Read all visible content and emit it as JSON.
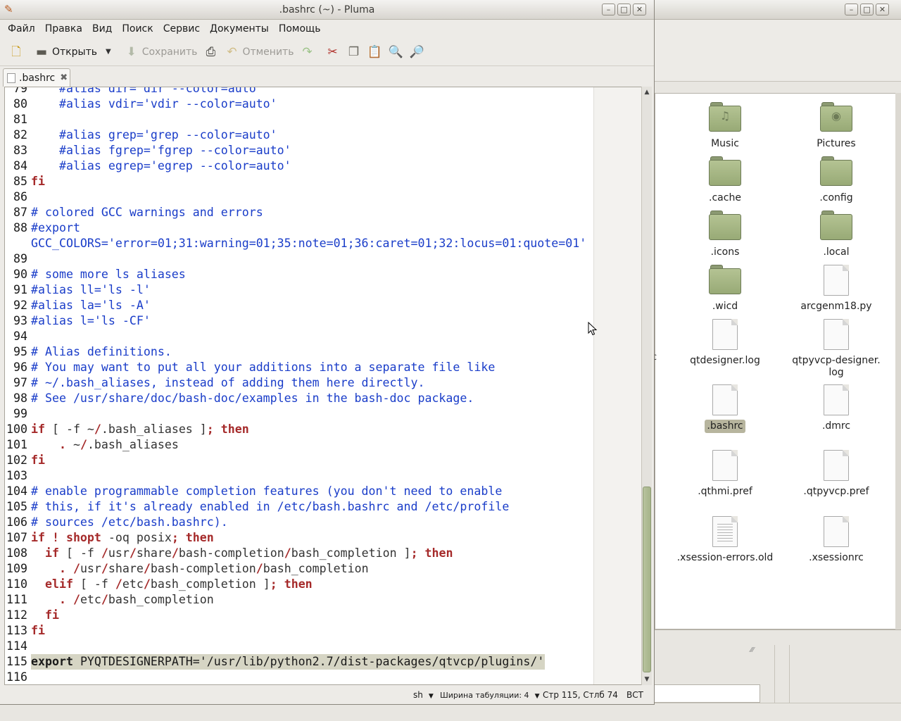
{
  "pluma": {
    "title": ".bashrc (~) - Pluma",
    "menus": [
      "Файл",
      "Правка",
      "Вид",
      "Поиск",
      "Сервис",
      "Документы",
      "Помощь"
    ],
    "toolbar": {
      "new_icon": "new-document-icon",
      "open_label": "Открыть",
      "save_label": "Сохранить",
      "undo_label": "Отменить"
    },
    "tab": {
      "name": ".bashrc"
    },
    "status": {
      "language": "sh",
      "tab_width": "Ширина табуляции: 4",
      "position": "Стр 115, Стлб 74",
      "mode": "ВСТ"
    }
  },
  "editor": {
    "lines": [
      {
        "n": "79",
        "segs": [
          {
            "c": "c-com",
            "t": "    #alias dir='dir --color=auto'"
          }
        ]
      },
      {
        "n": "80",
        "segs": [
          {
            "c": "c-com",
            "t": "    #alias vdir='vdir --color=auto'"
          }
        ]
      },
      {
        "n": "81",
        "segs": []
      },
      {
        "n": "82",
        "segs": [
          {
            "c": "c-com",
            "t": "    #alias grep='grep --color=auto'"
          }
        ]
      },
      {
        "n": "83",
        "segs": [
          {
            "c": "c-com",
            "t": "    #alias fgrep='fgrep --color=auto'"
          }
        ]
      },
      {
        "n": "84",
        "segs": [
          {
            "c": "c-com",
            "t": "    #alias egrep='egrep --color=auto'"
          }
        ]
      },
      {
        "n": "85",
        "segs": [
          {
            "c": "c-kw",
            "t": "fi"
          }
        ]
      },
      {
        "n": "86",
        "segs": []
      },
      {
        "n": "87",
        "segs": [
          {
            "c": "c-com",
            "t": "# colored GCC warnings and errors"
          }
        ]
      },
      {
        "n": "88",
        "segs": [
          {
            "c": "c-com",
            "t": "#export"
          }
        ]
      },
      {
        "n": "",
        "segs": [
          {
            "c": "c-com",
            "t": "GCC_COLORS='error=01;31:warning=01;35:note=01;36:caret=01;32:locus=01:quote=01'"
          }
        ]
      },
      {
        "n": "89",
        "segs": []
      },
      {
        "n": "90",
        "segs": [
          {
            "c": "c-com",
            "t": "# some more ls aliases"
          }
        ]
      },
      {
        "n": "91",
        "segs": [
          {
            "c": "c-com",
            "t": "#alias ll='ls -l'"
          }
        ]
      },
      {
        "n": "92",
        "segs": [
          {
            "c": "c-com",
            "t": "#alias la='ls -A'"
          }
        ]
      },
      {
        "n": "93",
        "segs": [
          {
            "c": "c-com",
            "t": "#alias l='ls -CF'"
          }
        ]
      },
      {
        "n": "94",
        "segs": []
      },
      {
        "n": "95",
        "segs": [
          {
            "c": "c-com",
            "t": "# Alias definitions."
          }
        ]
      },
      {
        "n": "96",
        "segs": [
          {
            "c": "c-com",
            "t": "# You may want to put all your additions into a separate file like"
          }
        ]
      },
      {
        "n": "97",
        "segs": [
          {
            "c": "c-com",
            "t": "# ~/.bash_aliases, instead of adding them here directly."
          }
        ]
      },
      {
        "n": "98",
        "segs": [
          {
            "c": "c-com",
            "t": "# See /usr/share/doc/bash-doc/examples in the bash-doc package."
          }
        ]
      },
      {
        "n": "99",
        "segs": []
      },
      {
        "n": "100",
        "segs": [
          {
            "c": "c-kw",
            "t": "if"
          },
          {
            "c": "c-txt",
            "t": " [ -f ~"
          },
          {
            "c": "c-kw",
            "t": "/"
          },
          {
            "c": "c-txt",
            "t": ".bash_aliases ]"
          },
          {
            "c": "c-kw",
            "t": "; then"
          }
        ]
      },
      {
        "n": "101",
        "segs": [
          {
            "c": "c-kw",
            "t": "    ."
          },
          {
            "c": "c-txt",
            "t": " ~"
          },
          {
            "c": "c-kw",
            "t": "/"
          },
          {
            "c": "c-txt",
            "t": ".bash_aliases"
          }
        ]
      },
      {
        "n": "102",
        "segs": [
          {
            "c": "c-kw",
            "t": "fi"
          }
        ]
      },
      {
        "n": "103",
        "segs": []
      },
      {
        "n": "104",
        "segs": [
          {
            "c": "c-com",
            "t": "# enable programmable completion features (you don't need to enable"
          }
        ]
      },
      {
        "n": "105",
        "segs": [
          {
            "c": "c-com",
            "t": "# this, if it's already enabled in /etc/bash.bashrc and /etc/profile"
          }
        ]
      },
      {
        "n": "106",
        "segs": [
          {
            "c": "c-com",
            "t": "# sources /etc/bash.bashrc)."
          }
        ]
      },
      {
        "n": "107",
        "segs": [
          {
            "c": "c-kw",
            "t": "if ! shopt"
          },
          {
            "c": "c-txt",
            "t": " -oq posix"
          },
          {
            "c": "c-kw",
            "t": "; then"
          }
        ]
      },
      {
        "n": "108",
        "segs": [
          {
            "c": "c-kw",
            "t": "  if"
          },
          {
            "c": "c-txt",
            "t": " [ -f "
          },
          {
            "c": "c-kw",
            "t": "/"
          },
          {
            "c": "c-txt",
            "t": "usr"
          },
          {
            "c": "c-kw",
            "t": "/"
          },
          {
            "c": "c-txt",
            "t": "share"
          },
          {
            "c": "c-kw",
            "t": "/"
          },
          {
            "c": "c-txt",
            "t": "bash-completion"
          },
          {
            "c": "c-kw",
            "t": "/"
          },
          {
            "c": "c-txt",
            "t": "bash_completion ]"
          },
          {
            "c": "c-kw",
            "t": "; then"
          }
        ]
      },
      {
        "n": "109",
        "segs": [
          {
            "c": "c-kw",
            "t": "    . /"
          },
          {
            "c": "c-txt",
            "t": "usr"
          },
          {
            "c": "c-kw",
            "t": "/"
          },
          {
            "c": "c-txt",
            "t": "share"
          },
          {
            "c": "c-kw",
            "t": "/"
          },
          {
            "c": "c-txt",
            "t": "bash-completion"
          },
          {
            "c": "c-kw",
            "t": "/"
          },
          {
            "c": "c-txt",
            "t": "bash_completion"
          }
        ]
      },
      {
        "n": "110",
        "segs": [
          {
            "c": "c-kw",
            "t": "  elif"
          },
          {
            "c": "c-txt",
            "t": " [ -f "
          },
          {
            "c": "c-kw",
            "t": "/"
          },
          {
            "c": "c-txt",
            "t": "etc"
          },
          {
            "c": "c-kw",
            "t": "/"
          },
          {
            "c": "c-txt",
            "t": "bash_completion ]"
          },
          {
            "c": "c-kw",
            "t": "; then"
          }
        ]
      },
      {
        "n": "111",
        "segs": [
          {
            "c": "c-kw",
            "t": "    . /"
          },
          {
            "c": "c-txt",
            "t": "etc"
          },
          {
            "c": "c-kw",
            "t": "/"
          },
          {
            "c": "c-txt",
            "t": "bash_completion"
          }
        ]
      },
      {
        "n": "112",
        "segs": [
          {
            "c": "c-kw",
            "t": "  fi"
          }
        ]
      },
      {
        "n": "113",
        "segs": [
          {
            "c": "c-kw",
            "t": "fi"
          }
        ]
      },
      {
        "n": "114",
        "segs": []
      },
      {
        "n": "115",
        "hl": true,
        "segs": [
          {
            "c": "c-bold",
            "t": "export"
          },
          {
            "c": "c-var",
            "t": " PYQTDESIGNERPATH="
          },
          {
            "c": "c-hlstr",
            "t": "'/usr/lib/python2.7/dist-packages/qtvcp/plugins/'"
          }
        ]
      },
      {
        "n": "116",
        "segs": []
      }
    ]
  },
  "file_manager": {
    "items": [
      {
        "label": "Music",
        "kind": "folder",
        "icon": "music-folder-icon",
        "emblem": "♫"
      },
      {
        "label": "Pictures",
        "kind": "folder",
        "icon": "pictures-folder-icon",
        "emblem": "◉"
      },
      {
        "label": ".cache",
        "kind": "folder",
        "icon": "folder-icon",
        "emblem": ""
      },
      {
        "label": ".config",
        "kind": "folder",
        "icon": "folder-icon",
        "emblem": ""
      },
      {
        "label": ".icons",
        "kind": "folder",
        "icon": "folder-icon",
        "emblem": ""
      },
      {
        "label": ".local",
        "kind": "folder",
        "icon": "folder-icon",
        "emblem": ""
      },
      {
        "label": ".wicd",
        "kind": "folder",
        "icon": "folder-icon",
        "emblem": ""
      },
      {
        "label": "arcgenm18.py",
        "kind": "file",
        "icon": "text-file-icon"
      },
      {
        "label": "qtdesigner.log",
        "kind": "file",
        "icon": "text-file-icon"
      },
      {
        "label": "qtpyvcp-designer.\nlog",
        "kind": "file",
        "icon": "text-file-icon"
      },
      {
        "label": ".bashrc",
        "kind": "file",
        "icon": "text-file-icon",
        "selected": true
      },
      {
        "label": ".dmrc",
        "kind": "file",
        "icon": "text-file-icon"
      },
      {
        "label": ".qthmi.pref",
        "kind": "file",
        "icon": "text-file-icon"
      },
      {
        "label": ".qtpyvcp.pref",
        "kind": "file",
        "icon": "text-file-icon"
      },
      {
        "label": ".xsession-errors.old",
        "kind": "file-lines",
        "icon": "text-file-icon"
      },
      {
        "label": ".xsessionrc",
        "kind": "file",
        "icon": "text-file-icon"
      }
    ],
    "cut_text": "c"
  }
}
